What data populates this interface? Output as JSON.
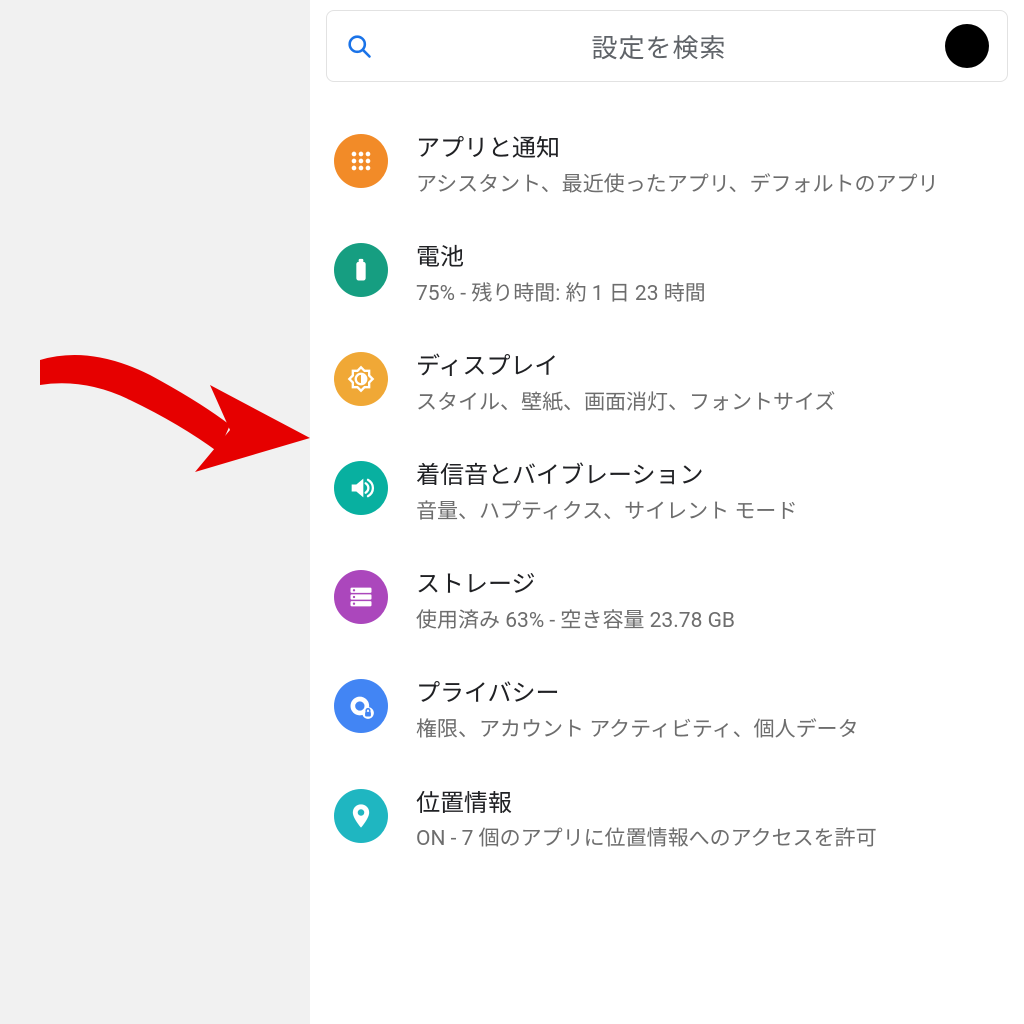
{
  "search": {
    "placeholder": "設定を検索"
  },
  "items": [
    {
      "id": "apps",
      "title": "アプリと通知",
      "subtitle": "アシスタント、最近使ったアプリ、デフォルトのアプリ"
    },
    {
      "id": "battery",
      "title": "電池",
      "subtitle": "75% - 残り時間: 約 1 日 23 時間"
    },
    {
      "id": "display",
      "title": "ディスプレイ",
      "subtitle": "スタイル、壁紙、画面消灯、フォントサイズ"
    },
    {
      "id": "sound",
      "title": "着信音とバイブレーション",
      "subtitle": "音量、ハプティクス、サイレント モード"
    },
    {
      "id": "storage",
      "title": "ストレージ",
      "subtitle": "使用済み 63% - 空き容量 23.78 GB"
    },
    {
      "id": "privacy",
      "title": "プライバシー",
      "subtitle": "権限、アカウント アクティビティ、個人データ"
    },
    {
      "id": "location",
      "title": "位置情報",
      "subtitle": "ON - 7 個のアプリに位置情報へのアクセスを許可"
    }
  ],
  "annotation": {
    "target": "display",
    "color": "#e60000"
  }
}
